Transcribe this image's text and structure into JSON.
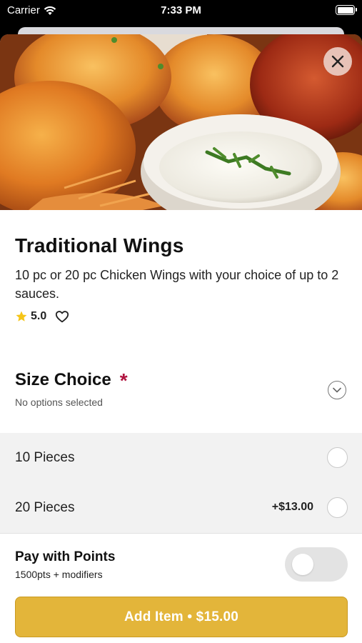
{
  "status_bar": {
    "carrier": "Carrier",
    "time": "7:33 PM",
    "wifi_icon": "wifi-icon",
    "battery_icon": "battery-icon"
  },
  "hero": {
    "image": "chicken-wings-with-dipping-sauce",
    "close_icon": "close-icon"
  },
  "item": {
    "title": "Traditional Wings",
    "description": "10 pc or 20 pc  Chicken Wings with your choice of up to 2 sauces.",
    "rating": "5.0",
    "star_icon": "star-icon",
    "favorite_icon": "heart-icon"
  },
  "size_choice": {
    "title": "Size Choice",
    "required_mark": "*",
    "subtitle": "No options selected",
    "toggle_icon": "chevron-down-icon",
    "options": [
      {
        "label": "10 Pieces",
        "price": ""
      },
      {
        "label": "20 Pieces",
        "price": "+$13.00"
      }
    ]
  },
  "points": {
    "title": "Pay with Points",
    "subtitle": "1500pts + modifiers",
    "enabled": false
  },
  "add_button": {
    "label": "Add Item • $15.00"
  },
  "colors": {
    "accent": "#e3b53a",
    "required": "#b0133f",
    "star": "#f5c518"
  }
}
